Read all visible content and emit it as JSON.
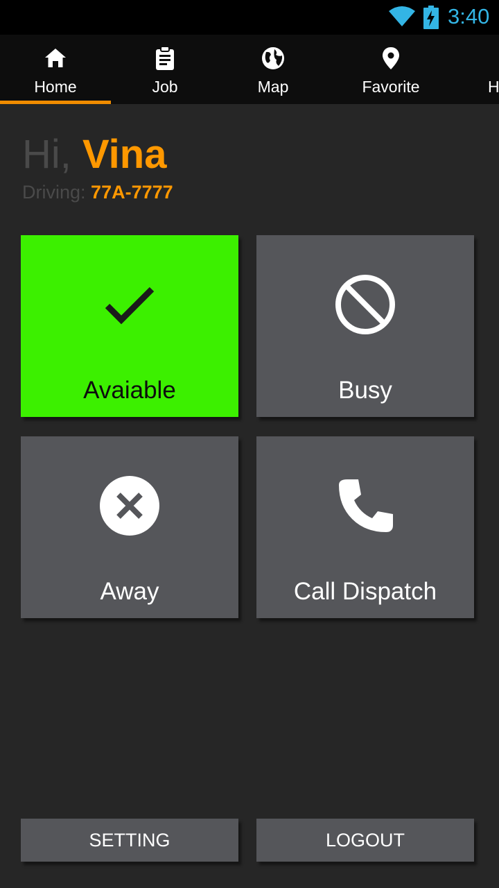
{
  "status_bar": {
    "time": "3:40",
    "wifi_icon": "wifi-icon",
    "battery_icon": "battery-charging-icon",
    "accent_color": "#33b5e5"
  },
  "nav": {
    "tabs": [
      {
        "label": "Home",
        "icon": "home-icon",
        "selected": true
      },
      {
        "label": "Job",
        "icon": "clipboard-icon",
        "selected": false
      },
      {
        "label": "Map",
        "icon": "globe-icon",
        "selected": false
      },
      {
        "label": "Favorite",
        "icon": "location-pin-icon",
        "selected": false
      },
      {
        "label": "H",
        "icon": "",
        "selected": false
      }
    ],
    "indicator_color": "#f08c00"
  },
  "greeting": {
    "prefix": "Hi,",
    "name": "Vina",
    "driving_label": "Driving:",
    "plate": "77A-7777"
  },
  "tiles": [
    {
      "label": "Avaiable",
      "icon": "checkmark-icon",
      "active": true,
      "color": "#3cf000"
    },
    {
      "label": "Busy",
      "icon": "block-icon",
      "active": false
    },
    {
      "label": "Away",
      "icon": "cancel-circle-icon",
      "active": false
    },
    {
      "label": "Call Dispatch",
      "icon": "phone-icon",
      "active": false
    }
  ],
  "buttons": {
    "setting": "SETTING",
    "logout": "LOGOUT"
  },
  "colors": {
    "accent": "#ff9800",
    "background": "#262626",
    "tile": "#55565a"
  }
}
